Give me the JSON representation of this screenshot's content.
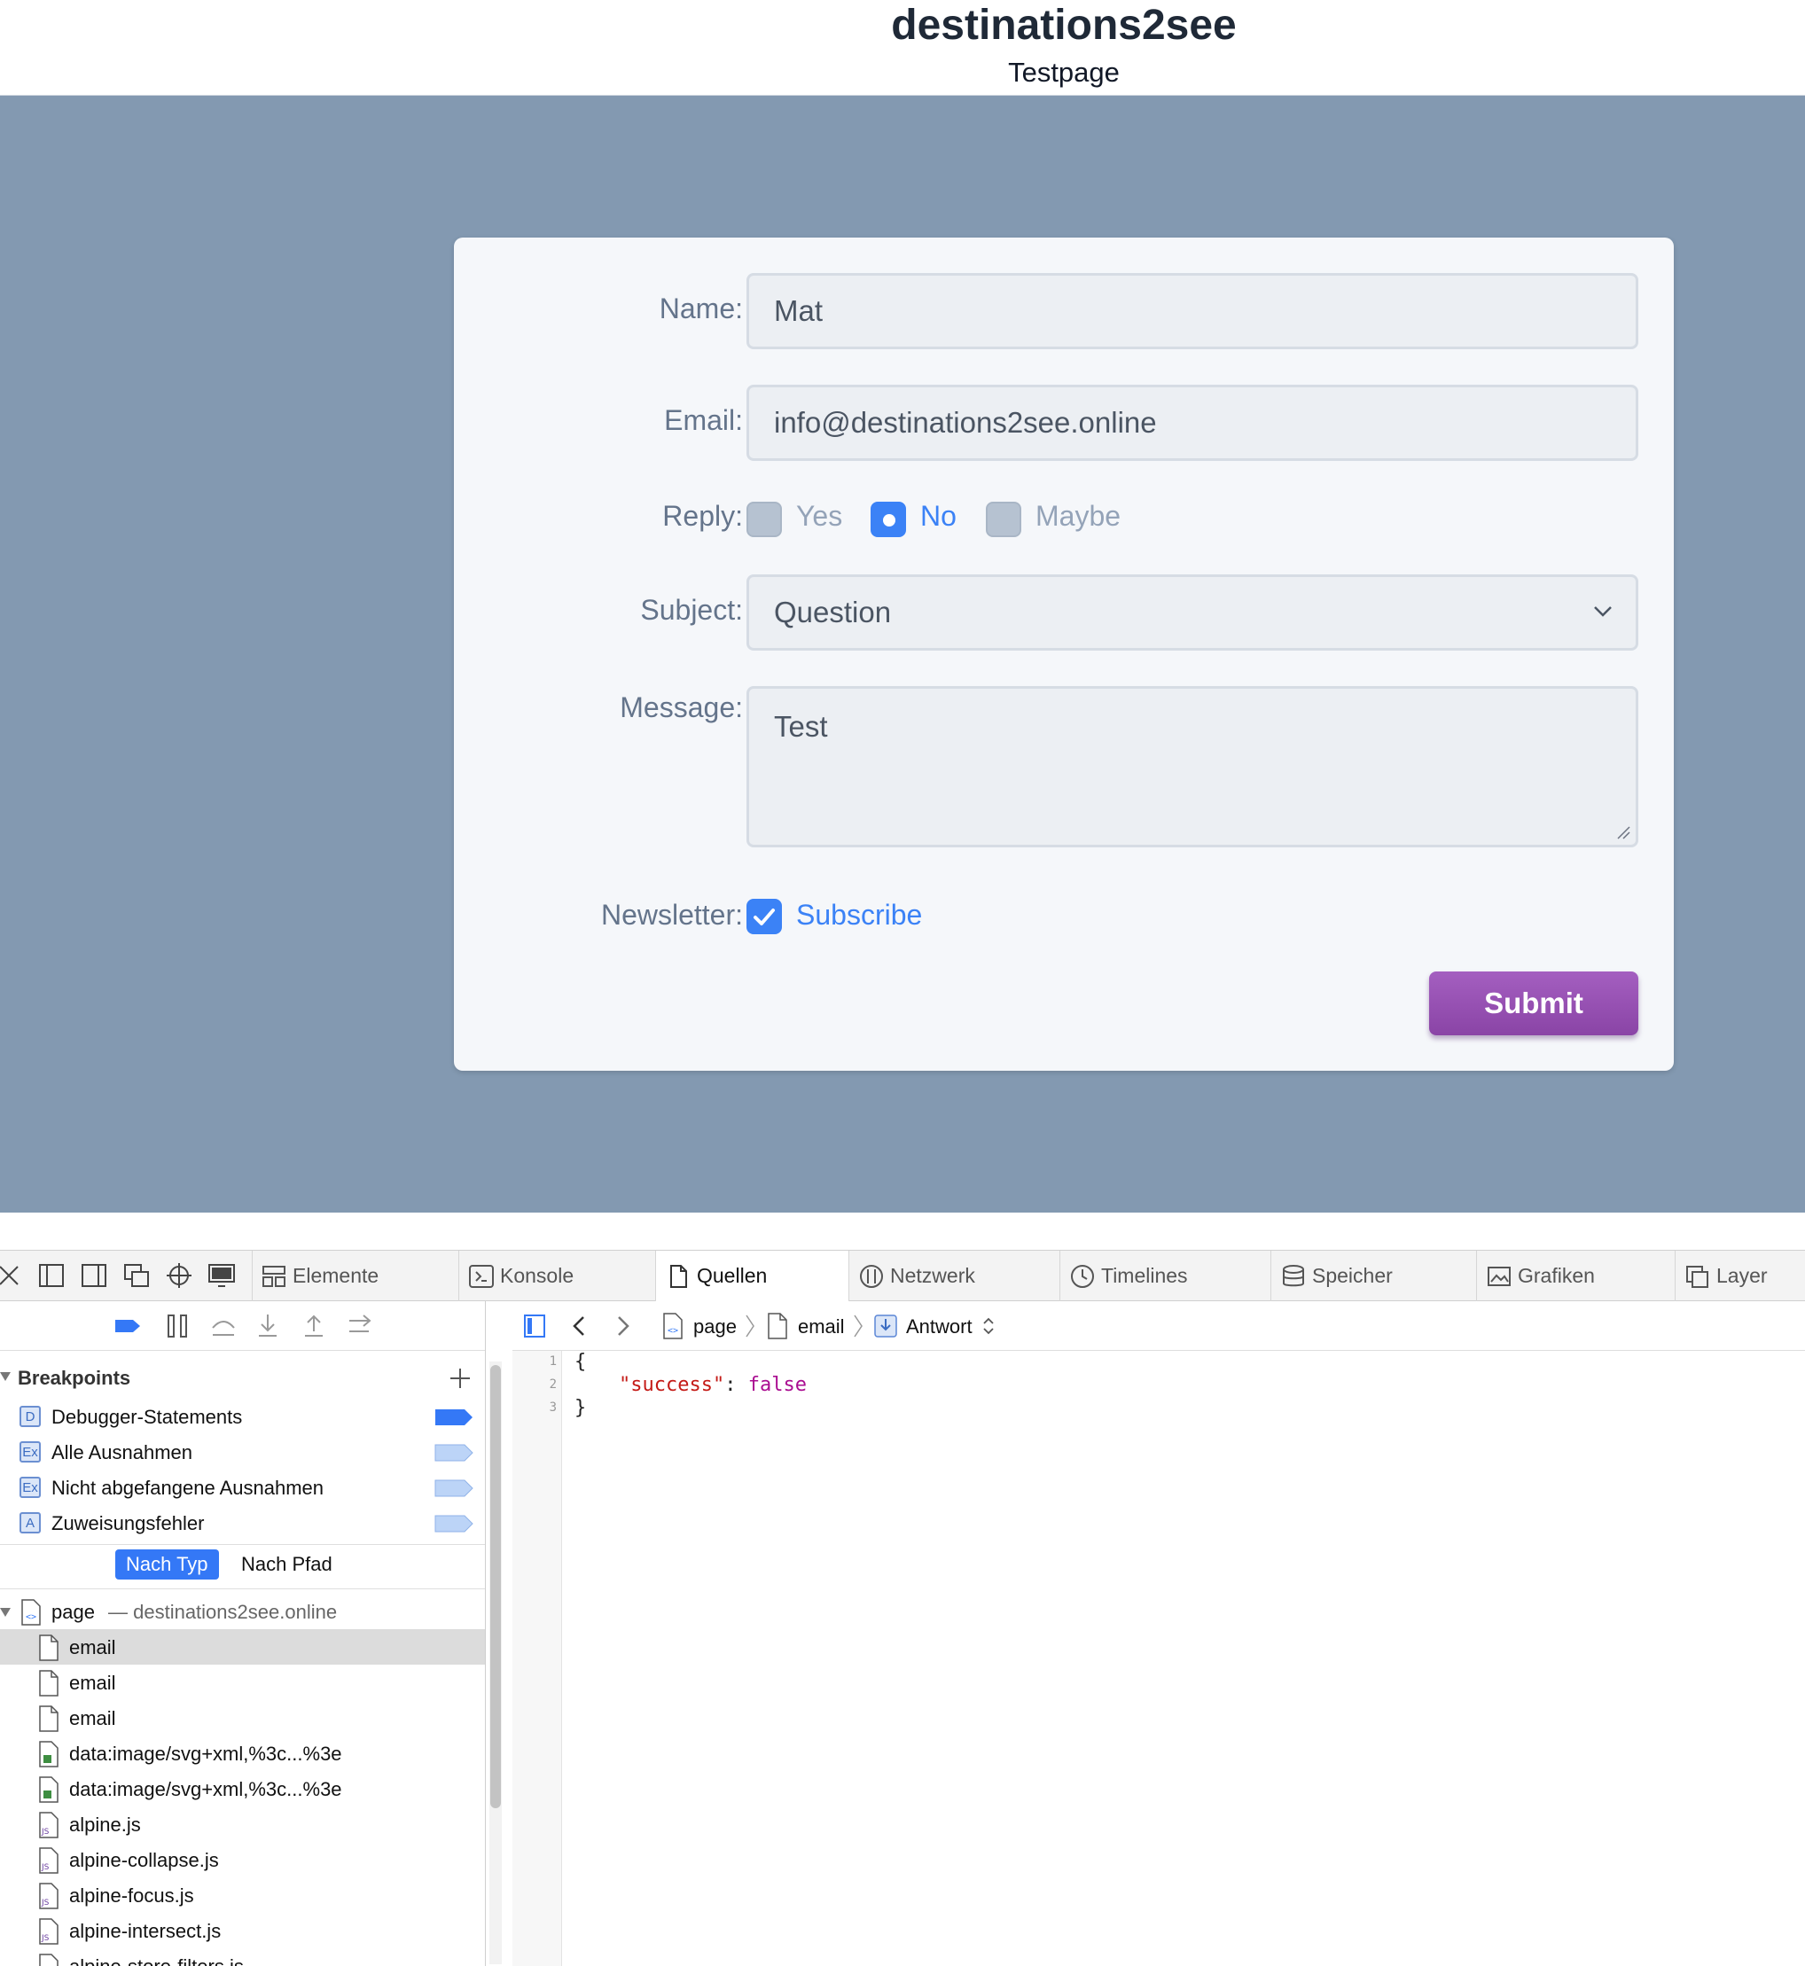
{
  "site": {
    "title": "destinations2see",
    "subtitle": "Testpage"
  },
  "form": {
    "name_label": "Name:",
    "name_value": "Mat",
    "email_label": "Email:",
    "email_value": "info@destinations2see.online",
    "reply_label": "Reply:",
    "reply_options": [
      "Yes",
      "No",
      "Maybe"
    ],
    "reply_selected": "No",
    "subject_label": "Subject:",
    "subject_value": "Question",
    "message_label": "Message:",
    "message_value": "Test",
    "newsletter_label": "Newsletter:",
    "newsletter_option": "Subscribe",
    "newsletter_checked": true,
    "submit_label": "Submit",
    "colors": {
      "accent": "#3b82f6",
      "submit": "#9b55b8",
      "background": "#8399b1"
    }
  },
  "devtools": {
    "tabs": [
      "Elemente",
      "Konsole",
      "Quellen",
      "Netzwerk",
      "Timelines",
      "Speicher",
      "Grafiken",
      "Layer"
    ],
    "active_tab": "Quellen",
    "breakpoints_header": "Breakpoints",
    "breakpoints": [
      {
        "badge": "D",
        "label": "Debugger-Statements",
        "active": true
      },
      {
        "badge": "Ex",
        "label": "Alle Ausnahmen",
        "active": false
      },
      {
        "badge": "Ex",
        "label": "Nicht abgefangene Ausnahmen",
        "active": false
      },
      {
        "badge": "A",
        "label": "Zuweisungsfehler",
        "active": false
      }
    ],
    "filter_by_type": "Nach Typ",
    "filter_by_path": "Nach Pfad",
    "page_resource": "page",
    "page_domain": "— destinations2see.online",
    "files": [
      {
        "label": "email",
        "kind": "doc",
        "selected": true
      },
      {
        "label": "email",
        "kind": "doc",
        "selected": false
      },
      {
        "label": "email",
        "kind": "doc",
        "selected": false
      },
      {
        "label": "data:image/svg+xml,%3c...%3e",
        "kind": "img",
        "selected": false
      },
      {
        "label": "data:image/svg+xml,%3c...%3e",
        "kind": "img",
        "selected": false
      },
      {
        "label": "alpine.js",
        "kind": "js",
        "selected": false
      },
      {
        "label": "alpine-collapse.js",
        "kind": "js",
        "selected": false
      },
      {
        "label": "alpine-focus.js",
        "kind": "js",
        "selected": false
      },
      {
        "label": "alpine-intersect.js",
        "kind": "js",
        "selected": false
      },
      {
        "label": "alpine-store-filters.js",
        "kind": "js",
        "selected": false
      }
    ],
    "path": {
      "page": "page",
      "resource": "email",
      "mode": "Antwort"
    },
    "code_lines": [
      "1",
      "2",
      "3"
    ],
    "code": {
      "open": "{",
      "key": "\"success\"",
      "colon": ": ",
      "value": "false",
      "close": "}"
    }
  }
}
